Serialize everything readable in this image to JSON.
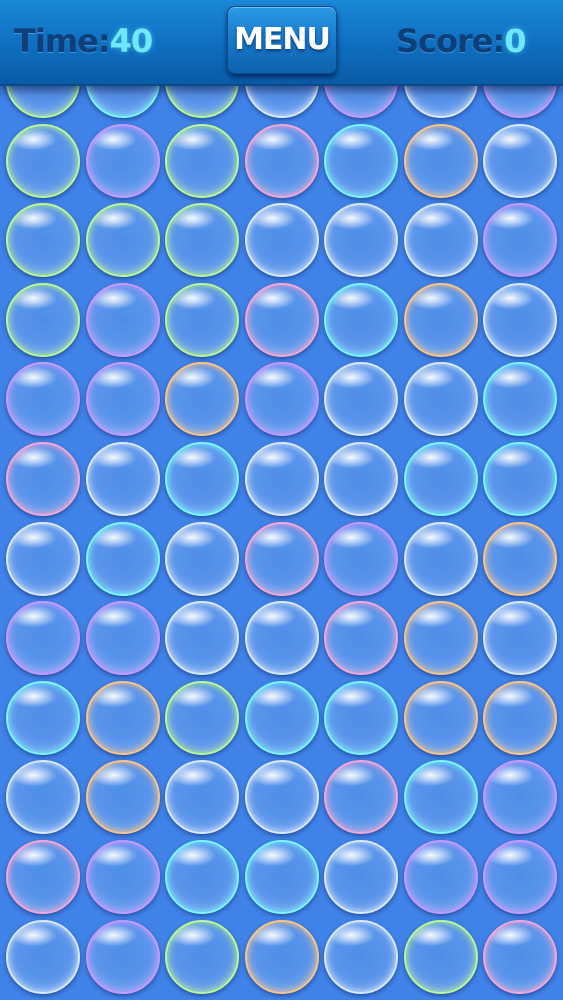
{
  "hud": {
    "time_label": "Time:",
    "time_value": "40",
    "score_label": "Score:",
    "score_value": "0",
    "menu_label": "MENU"
  },
  "colors": {
    "background": "#3f82e8",
    "header": "#1172c6",
    "hud_label": "#0f3f78",
    "hud_value": "#6ee8ff",
    "bubble_rims": {
      "cyan": "#7ff3ff",
      "green": "#b9f59a",
      "purple": "#c49bff",
      "orange": "#f6c48c",
      "pink": "#f2a8d6",
      "white": "#d9e8ff"
    }
  },
  "board": {
    "columns": 7,
    "rows": 12,
    "rim_colors": [
      [
        "g",
        "c",
        "g",
        "w",
        "p",
        "w",
        "p"
      ],
      [
        "g",
        "p",
        "g",
        "k",
        "c",
        "o",
        "w"
      ],
      [
        "g",
        "g",
        "g",
        "w",
        "w",
        "w",
        "p"
      ],
      [
        "g",
        "p",
        "g",
        "k",
        "c",
        "o",
        "w"
      ],
      [
        "p",
        "p",
        "o",
        "p",
        "w",
        "w",
        "c"
      ],
      [
        "k",
        "w",
        "c",
        "w",
        "w",
        "c",
        "c"
      ],
      [
        "w",
        "c",
        "w",
        "k",
        "p",
        "w",
        "o"
      ],
      [
        "p",
        "p",
        "w",
        "w",
        "k",
        "o",
        "w"
      ],
      [
        "c",
        "o",
        "g",
        "c",
        "c",
        "o",
        "o"
      ],
      [
        "w",
        "o",
        "w",
        "w",
        "k",
        "c",
        "p"
      ],
      [
        "k",
        "p",
        "c",
        "c",
        "w",
        "p",
        "p"
      ],
      [
        "w",
        "p",
        "g",
        "o",
        "w",
        "g",
        "k"
      ]
    ]
  }
}
